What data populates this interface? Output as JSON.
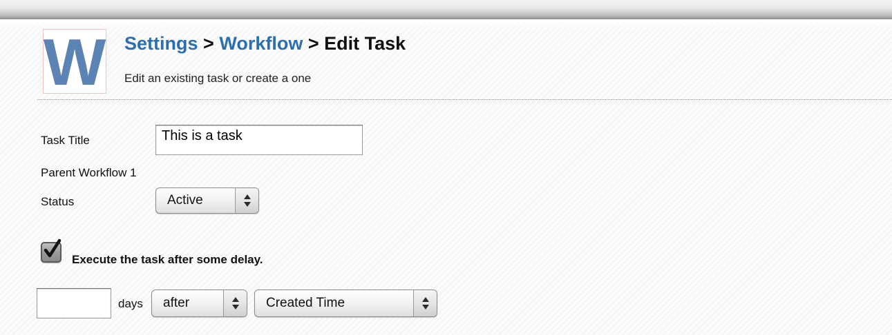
{
  "logo": {
    "letter": "W"
  },
  "breadcrumb": {
    "settings": "Settings",
    "workflow": "Workflow",
    "separator": ">",
    "current": "Edit Task"
  },
  "subtitle": "Edit an existing task or create a one",
  "form": {
    "task_title_label": "Task Title",
    "task_title_value": "This is a task",
    "parent_workflow_text": "Parent Workflow 1",
    "status_label": "Status",
    "status_value": "Active",
    "delay_checkbox_label": "Execute the task after some delay.",
    "delay_checked": true,
    "days_value": "",
    "days_label": "days",
    "relation_value": "after",
    "reference_value": "Created Time"
  },
  "icons": {
    "logo": "w-logo-icon",
    "select_arrows": "updown-chevron-icon",
    "check": "checkmark-icon"
  },
  "colors": {
    "link": "#2c6fb0",
    "logo": "#5b84b4",
    "logo_border": "#f1c3c3"
  }
}
